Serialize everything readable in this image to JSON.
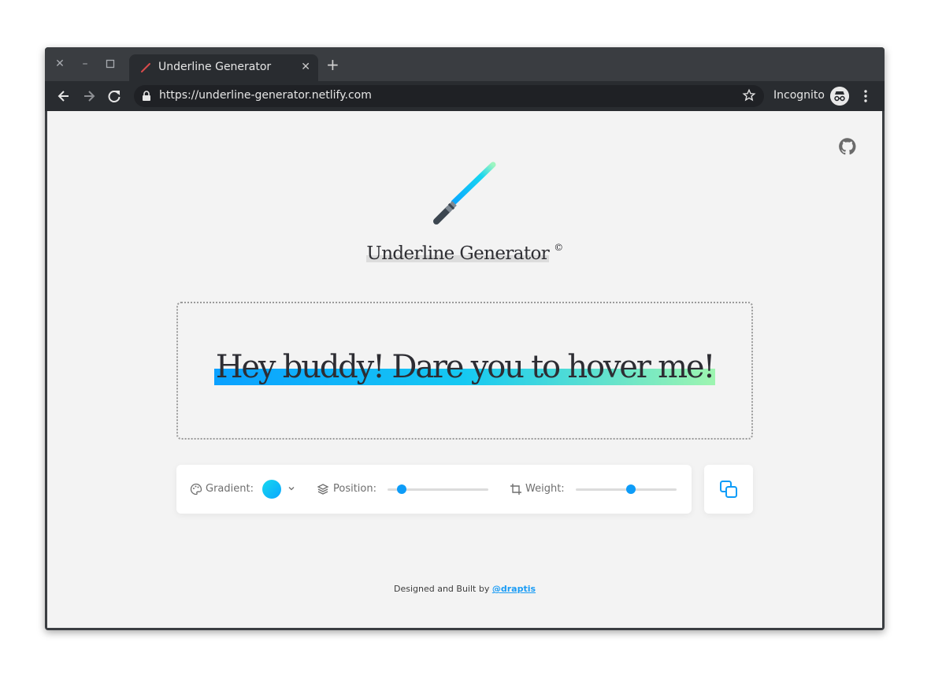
{
  "browser": {
    "tab_title": "Underline Generator",
    "url": "https://underline-generator.netlify.com",
    "incognito_label": "Incognito",
    "icons": [
      "close-icon",
      "minimize-icon",
      "maximize-icon",
      "back-icon",
      "forward-icon",
      "reload-icon",
      "lock-icon",
      "star-icon",
      "incognito-icon",
      "more-icon"
    ]
  },
  "page": {
    "title": "Underline Generator",
    "title_mark": "©",
    "preview_text": "Hey buddy! Dare you to hover me!",
    "controls": {
      "gradient_label": "Gradient:",
      "position_label": "Position:",
      "weight_label": "Weight:",
      "position_value": 0.14,
      "weight_value": 0.55
    },
    "footer": {
      "text": "Designed and Built by",
      "link": "@draptis"
    }
  },
  "colors": {
    "accent": "#0d9cf8",
    "gradient": [
      "#0aa0ff",
      "#16c9f2",
      "#9ef5b0"
    ],
    "page_bg": "#f3f3f3"
  }
}
